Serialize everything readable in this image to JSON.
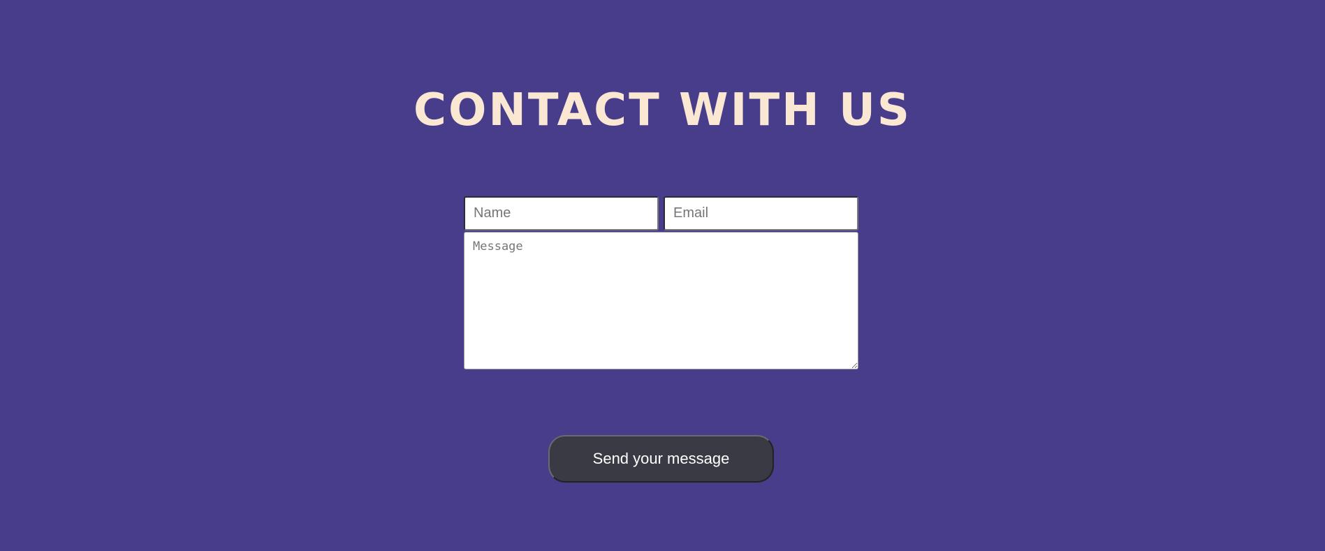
{
  "page": {
    "title": "CONTACT WITH US",
    "background_color": "#483d8b",
    "title_color": "#fbe8d3"
  },
  "form": {
    "name_placeholder": "Name",
    "email_placeholder": "Email",
    "message_placeholder": "Message",
    "name_value": "",
    "email_value": "",
    "message_value": ""
  },
  "submit": {
    "label": "Send your message",
    "background_color": "#3a3a44"
  }
}
